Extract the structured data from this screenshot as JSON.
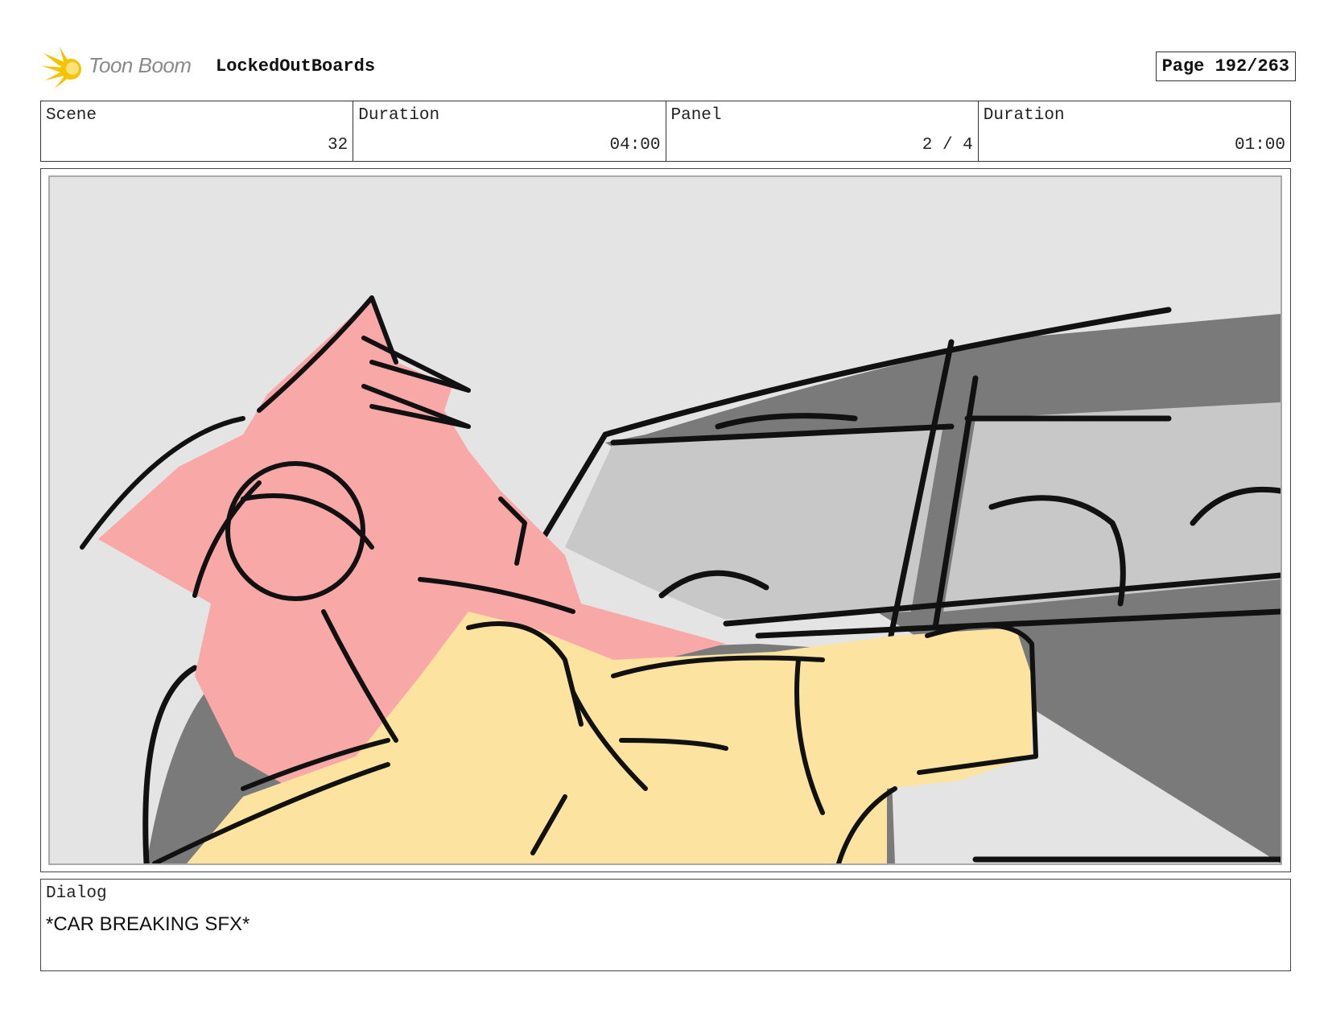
{
  "header": {
    "brand": "Toon Boom",
    "logo_icon": "toon-boom-burst-logo",
    "project_title": "LockedOutBoards",
    "page_label": "Page 192/263"
  },
  "info": {
    "scene": {
      "label": "Scene",
      "value": "32"
    },
    "scene_duration": {
      "label": "Duration",
      "value": "04:00"
    },
    "panel": {
      "label": "Panel",
      "value": "2 / 4"
    },
    "panel_duration": {
      "label": "Duration",
      "value": "01:00"
    }
  },
  "dialog": {
    "label": "Dialog",
    "text": "*CAR BREAKING SFX*"
  },
  "colors": {
    "logo_yellow": "#f5c400",
    "pink_character": "#f9a8a8",
    "yellow_character": "#fde3a0",
    "car_dark": "#7a7a7a",
    "car_window": "#c8c8c8",
    "background": "#e4e4e4"
  }
}
